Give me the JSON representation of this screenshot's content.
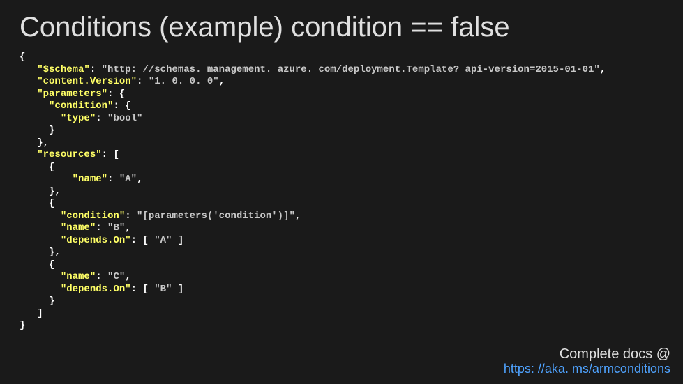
{
  "title": "Conditions  (example) condition == false",
  "code": {
    "schema_key": "\"$schema\"",
    "schema_val": "\"http: //schemas. management. azure. com/deployment.Template? api-version=2015-01-01\"",
    "contentVersion_key": "\"content.Version\"",
    "contentVersion_val": "\"1. 0. 0. 0\"",
    "parameters_key": "\"parameters\"",
    "condition_key": "\"condition\"",
    "type_key": "\"type\"",
    "type_val": "\"bool\"",
    "resources_key": "\"resources\"",
    "name_key": "\"name\"",
    "name_A": "\"A\"",
    "cond_expr": "\"[parameters('condition')]\"",
    "name_B": "\"B\"",
    "dependsOn_key": "\"depends.On\"",
    "dep_A": "\"A\"",
    "name_C": "\"C\"",
    "dep_B": "\"B\""
  },
  "footer": {
    "docs_label": "Complete docs @",
    "link_text": "https: //aka. ms/armconditions"
  }
}
